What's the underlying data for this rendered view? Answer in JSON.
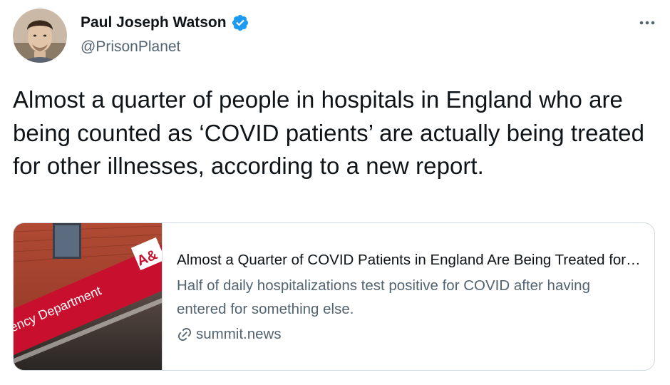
{
  "author": {
    "display_name": "Paul Joseph Watson",
    "handle": "@PrisonPlanet",
    "verified": true,
    "avatar_icon": "avatar-portrait"
  },
  "tweet": {
    "text": "Almost a quarter of people in hospitals in England who are being counted as ‘COVID patients’ are actually being treated for other illnesses, according to a new report."
  },
  "card": {
    "title": "Almost a Quarter of COVID Patients in England Are Being Treated for Other Illnesses",
    "description": "Half of daily hospitalizations test positive for COVID after having entered for something else.",
    "domain": "summit.news",
    "image_sign_text": "ency Department",
    "image_sign_badge": "A&",
    "link_icon": "link-icon"
  },
  "colors": {
    "verified_blue": "#1d9bf0",
    "secondary_text": "#536471",
    "border": "#cfd9de",
    "sign_red": "#c8102e"
  },
  "icons": {
    "more": "more-horizontal-icon",
    "verified": "verified-badge-icon"
  }
}
